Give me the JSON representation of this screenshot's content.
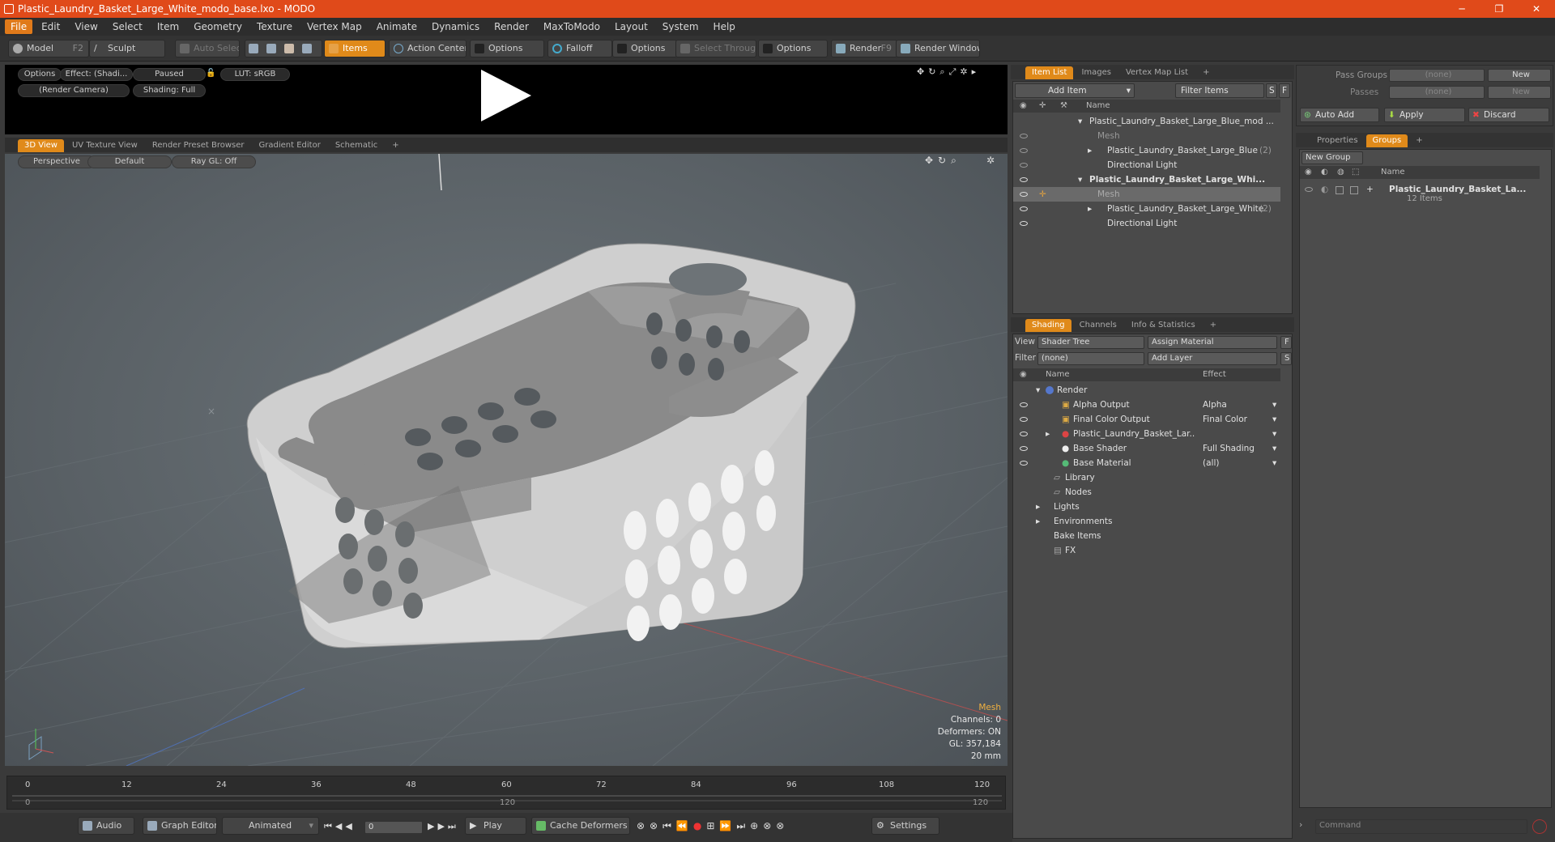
{
  "window": {
    "title": "Plastic_Laundry_Basket_Large_White_modo_base.lxo - MODO",
    "btn_min": "─",
    "btn_max": "❐",
    "btn_close": "✕"
  },
  "menu": [
    "File",
    "Edit",
    "View",
    "Select",
    "Item",
    "Geometry",
    "Texture",
    "Vertex Map",
    "Animate",
    "Dynamics",
    "Render",
    "MaxToModo",
    "Layout",
    "System",
    "Help"
  ],
  "toolbar": {
    "model": "Model",
    "model_key": "F2",
    "sculpt": "Sculpt",
    "auto_select": "Auto Select",
    "items": "Items",
    "action_center": "Action Center",
    "options1": "Options",
    "falloff": "Falloff",
    "options2": "Options",
    "select_through": "Select Through",
    "options3": "Options",
    "render": "Render",
    "render_key": "F9",
    "render_window": "Render Window"
  },
  "preview": {
    "options": "Options",
    "effect": "Effect: (Shadi...",
    "paused": "Paused",
    "lut": "LUT: sRGB",
    "camera": "(Render Camera)",
    "shading": "Shading: Full"
  },
  "viewport_tabs": [
    "3D View",
    "UV Texture View",
    "Render Preset Browser",
    "Gradient Editor",
    "Schematic"
  ],
  "viewport": {
    "perspective": "Perspective",
    "default": "Default",
    "raygl": "Ray GL: Off",
    "info": {
      "mesh": "Mesh",
      "channels": "Channels: 0",
      "deformers": "Deformers: ON",
      "gl": "GL: 357,184",
      "mm": "20 mm"
    }
  },
  "timeline": {
    "ticks": [
      "0",
      "12",
      "24",
      "36",
      "48",
      "60",
      "72",
      "84",
      "96",
      "108",
      "120"
    ],
    "start": "0",
    "mid": "120",
    "end": "120"
  },
  "transport": {
    "audio": "Audio",
    "graph_editor": "Graph Editor",
    "animated": "Animated",
    "frame": "0",
    "play": "Play",
    "cache_deformers": "Cache Deformers",
    "settings": "Settings"
  },
  "item_list": {
    "tabs": [
      "Item List",
      "Images",
      "Vertex Map List"
    ],
    "add_item": "Add Item",
    "filter_items": "Filter Items",
    "s": "S",
    "f": "F",
    "col_name": "Name",
    "rows": [
      {
        "label": "Plastic_Laundry_Basket_Large_Blue_mod ...",
        "indent": 0,
        "bold": false,
        "dim": false,
        "count": ""
      },
      {
        "label": "Mesh",
        "indent": 1,
        "bold": false,
        "dim": true,
        "count": ""
      },
      {
        "label": "Plastic_Laundry_Basket_Large_Blue",
        "indent": 1,
        "bold": false,
        "dim": false,
        "count": "(2)"
      },
      {
        "label": "Directional Light",
        "indent": 1,
        "bold": false,
        "dim": false,
        "count": ""
      },
      {
        "label": "Plastic_Laundry_Basket_Large_Whi...",
        "indent": 0,
        "bold": true,
        "dim": false,
        "count": ""
      },
      {
        "label": "Mesh",
        "indent": 1,
        "bold": false,
        "dim": true,
        "count": ""
      },
      {
        "label": "Plastic_Laundry_Basket_Large_White",
        "indent": 1,
        "bold": false,
        "dim": false,
        "count": "(2)"
      },
      {
        "label": "Directional Light",
        "indent": 1,
        "bold": false,
        "dim": false,
        "count": ""
      }
    ]
  },
  "shading": {
    "tabs": [
      "Shading",
      "Channels",
      "Info & Statistics"
    ],
    "view_label": "View",
    "view_value": "Shader Tree",
    "assign_material": "Assign Material",
    "f": "F",
    "filter_label": "Filter",
    "filter_value": "(none)",
    "add_layer": "Add Layer",
    "s": "S",
    "col_name": "Name",
    "col_effect": "Effect",
    "rows": [
      {
        "label": "Render",
        "effect": "",
        "indent": 0
      },
      {
        "label": "Alpha Output",
        "effect": "Alpha",
        "indent": 1
      },
      {
        "label": "Final Color Output",
        "effect": "Final Color",
        "indent": 1
      },
      {
        "label": "Plastic_Laundry_Basket_Lar...",
        "effect": "",
        "indent": 1
      },
      {
        "label": "Base Shader",
        "effect": "Full Shading",
        "indent": 1
      },
      {
        "label": "Base Material",
        "effect": "(all)",
        "indent": 1
      },
      {
        "label": "Library",
        "effect": "",
        "indent": 0
      },
      {
        "label": "Nodes",
        "effect": "",
        "indent": 0
      },
      {
        "label": "Lights",
        "effect": "",
        "indent": -1
      },
      {
        "label": "Environments",
        "effect": "",
        "indent": -1
      },
      {
        "label": "Bake Items",
        "effect": "",
        "indent": -1
      },
      {
        "label": "FX",
        "effect": "",
        "indent": 0
      }
    ]
  },
  "groups": {
    "pass_groups_label": "Pass Groups",
    "pass_groups_value": "(none)",
    "new1": "New",
    "passes_label": "Passes",
    "passes_value": "(none)",
    "new2": "New",
    "auto_add": "Auto Add",
    "apply": "Apply",
    "discard": "Discard",
    "tabs": [
      "Properties",
      "Groups"
    ],
    "new_group": "New Group",
    "col_name": "Name",
    "group_name": "Plastic_Laundry_Basket_La...",
    "group_count": "12 Items",
    "command_placeholder": "Command"
  }
}
